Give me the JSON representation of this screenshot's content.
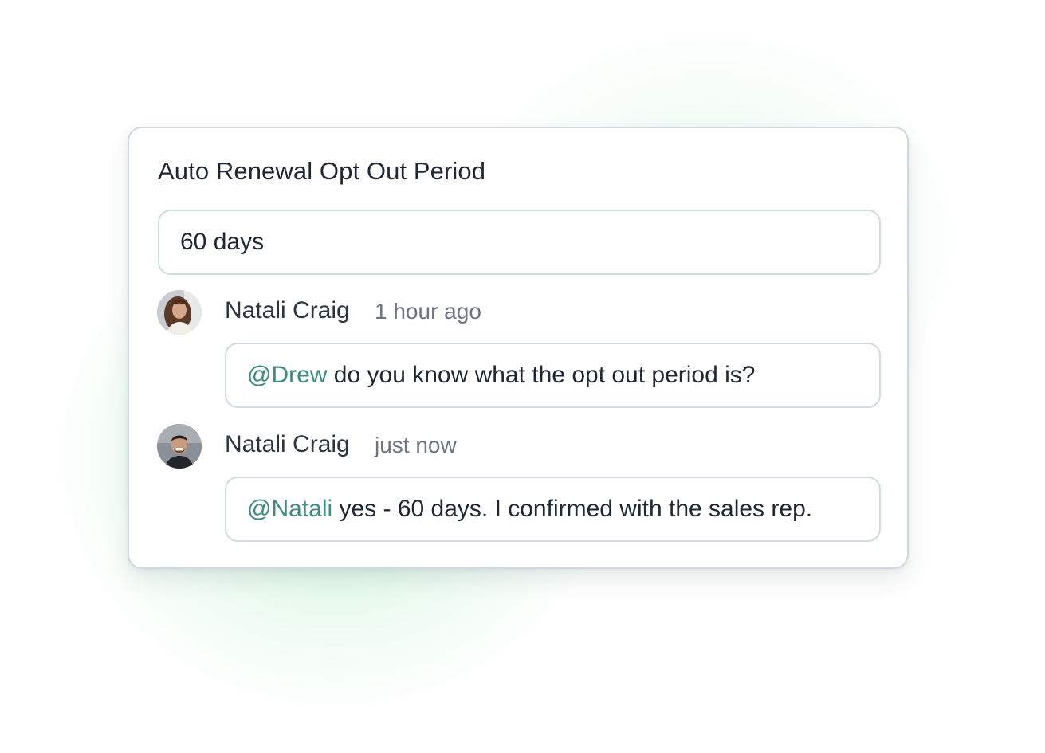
{
  "field": {
    "title": "Auto Renewal Opt Out Period",
    "value": "60 days"
  },
  "comments": [
    {
      "author": "Natali Craig",
      "time": "1 hour ago",
      "mention": "@Drew",
      "text": " do you know what the opt out period is?"
    },
    {
      "author": "Natali Craig",
      "time": "just now",
      "mention": "@Natali",
      "text": " yes - 60 days. I confirmed with the sales rep."
    }
  ],
  "colors": {
    "mention": "#3d8b83",
    "border": "#d2dae4",
    "glow": "#96e4b4"
  }
}
